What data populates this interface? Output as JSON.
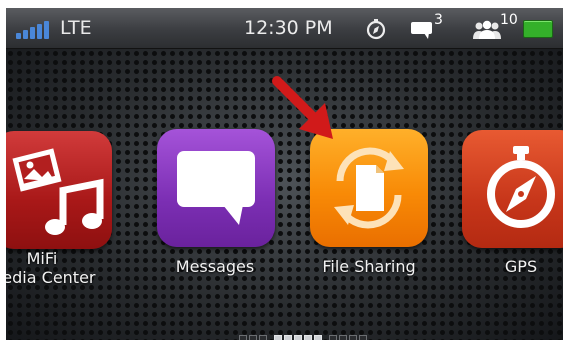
{
  "status_bar": {
    "network": "LTE",
    "time": "12:30 PM",
    "message_count": "3",
    "user_count": "10",
    "icons": [
      "signal-bars-icon",
      "compass-icon",
      "message-icon",
      "users-icon",
      "battery-icon"
    ],
    "battery_color": "#34b02a",
    "signal_color": "#4a87d8"
  },
  "apps": [
    {
      "label": "MiFi\nMedia Center",
      "icon": "media-center-icon",
      "color": "#b21f1f"
    },
    {
      "label": "Messages",
      "icon": "messages-icon",
      "color": "#7c2fb4"
    },
    {
      "label": "File Sharing",
      "icon": "file-sharing-icon",
      "color": "#f88a06"
    },
    {
      "label": "GPS",
      "icon": "gps-compass-icon",
      "color": "#c7361a"
    }
  ],
  "annotation": {
    "icon": "red-arrow-icon",
    "color": "#d11a1a"
  },
  "pager": {
    "total_pages": 9,
    "active_pages": 5,
    "first_active": 3
  }
}
